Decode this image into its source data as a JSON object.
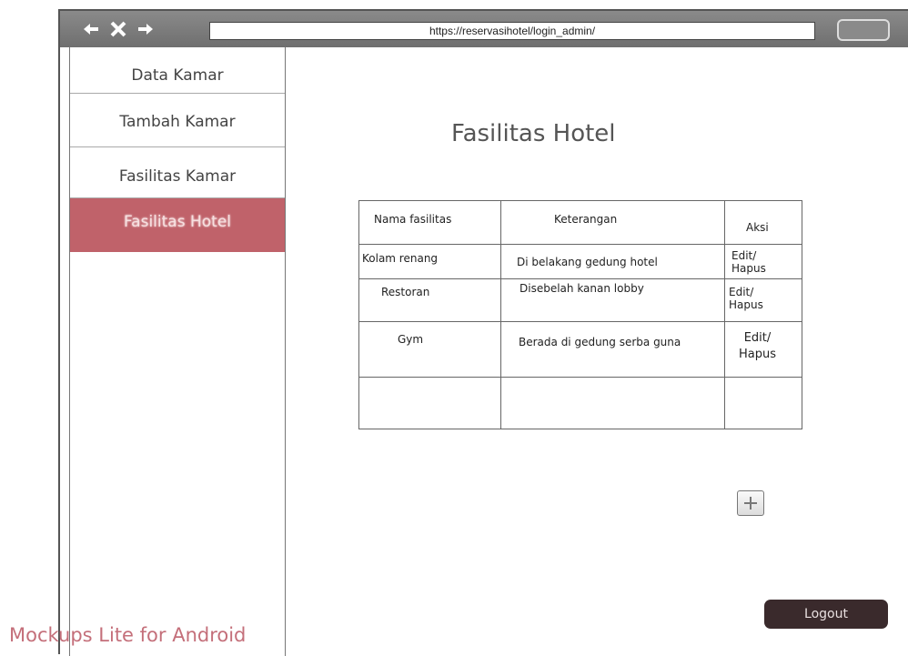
{
  "browser": {
    "url": "https://reservasihotel/login_admin/"
  },
  "sidebar": {
    "items": [
      {
        "label": "Data Kamar"
      },
      {
        "label": "Tambah Kamar"
      },
      {
        "label": "Fasilitas Kamar"
      },
      {
        "label": "Fasilitas Hotel"
      }
    ]
  },
  "main": {
    "title": "Fasilitas Hotel",
    "table": {
      "headers": [
        "Nama fasilitas",
        "Keterangan",
        "Aksi"
      ],
      "rows": [
        {
          "nama": "Kolam renang",
          "keterangan": "Di belakang gedung hotel",
          "aksi": "Edit/ Hapus"
        },
        {
          "nama": "Restoran",
          "keterangan": "Disebelah kanan lobby",
          "aksi": "Edit/ Hapus"
        },
        {
          "nama": "Gym",
          "keterangan": "Berada di gedung serba guna",
          "aksi": "Edit/ Hapus"
        }
      ]
    },
    "logout_label": "Logout"
  },
  "watermark": "Mockups Lite for Android",
  "icons": {
    "back": "arrow-left-icon",
    "close": "close-icon",
    "forward": "arrow-right-icon",
    "add": "plus-icon"
  },
  "colors": {
    "active_sidebar": "#c0626a",
    "logout_bg": "#3a2a2c",
    "watermark": "#c46f7a"
  }
}
